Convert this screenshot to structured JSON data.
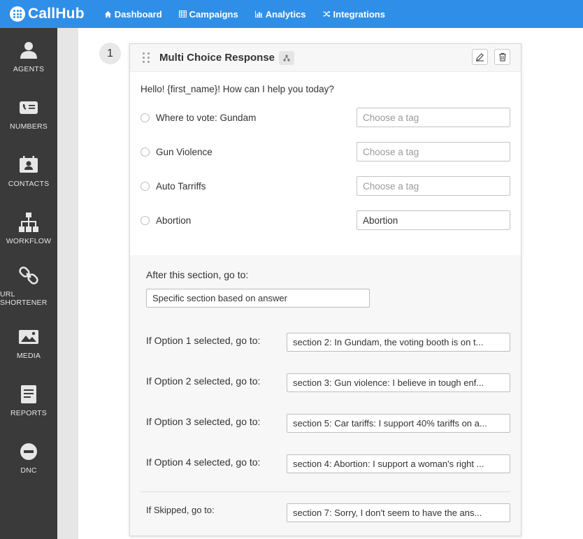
{
  "app": {
    "logo_text": "CallHub",
    "brand_color": "#2f8fe8"
  },
  "topnav": [
    {
      "label": "Dashboard",
      "icon": "home-icon"
    },
    {
      "label": "Campaigns",
      "icon": "table-icon"
    },
    {
      "label": "Analytics",
      "icon": "bar-chart-icon"
    },
    {
      "label": "Integrations",
      "icon": "shuffle-icon"
    }
  ],
  "sidebar": [
    {
      "label": "AGENTS",
      "icon": "user-icon"
    },
    {
      "label": "NUMBERS",
      "icon": "phone-card-icon"
    },
    {
      "label": "CONTACTS",
      "icon": "contact-card-icon"
    },
    {
      "label": "WORKFLOW",
      "icon": "sitemap-icon"
    },
    {
      "label": "URL SHORTENER",
      "icon": "link-icon"
    },
    {
      "label": "MEDIA",
      "icon": "image-icon"
    },
    {
      "label": "REPORTS",
      "icon": "report-icon"
    },
    {
      "label": "DNC",
      "icon": "minus-circle-icon"
    }
  ],
  "step": {
    "number": "1",
    "title": "Multi Choice Response",
    "type_icon": "branch-icon",
    "question": "Hello! {first_name}! How can I help you today?",
    "options": [
      {
        "label": "Where to vote: Gundam",
        "tag_value": "",
        "tag_placeholder": "Choose a tag"
      },
      {
        "label": "Gun Violence",
        "tag_value": "",
        "tag_placeholder": "Choose a tag"
      },
      {
        "label": "Auto Tarriffs",
        "tag_value": "",
        "tag_placeholder": "Choose a tag"
      },
      {
        "label": "Abortion",
        "tag_value": "Abortion",
        "tag_placeholder": "Choose a tag"
      }
    ],
    "after_label": "After this section, go to:",
    "after_value": "Specific section based on answer",
    "branches": [
      {
        "label": "If Option 1 selected, go to:",
        "value": "section 2: In Gundam, the voting booth is on t..."
      },
      {
        "label": "If Option 2 selected, go to:",
        "value": "section 3: Gun violence: I believe in tough enf..."
      },
      {
        "label": "If Option 3 selected, go to:",
        "value": "section 5: Car tariffs: I support 40% tariffs on a..."
      },
      {
        "label": "If Option 4 selected, go to:",
        "value": "section 4: Abortion: I support a woman's right ..."
      }
    ],
    "skip_label": "If Skipped, go to:",
    "skip_value": "section 7: Sorry, I don't seem to have the ans..."
  }
}
